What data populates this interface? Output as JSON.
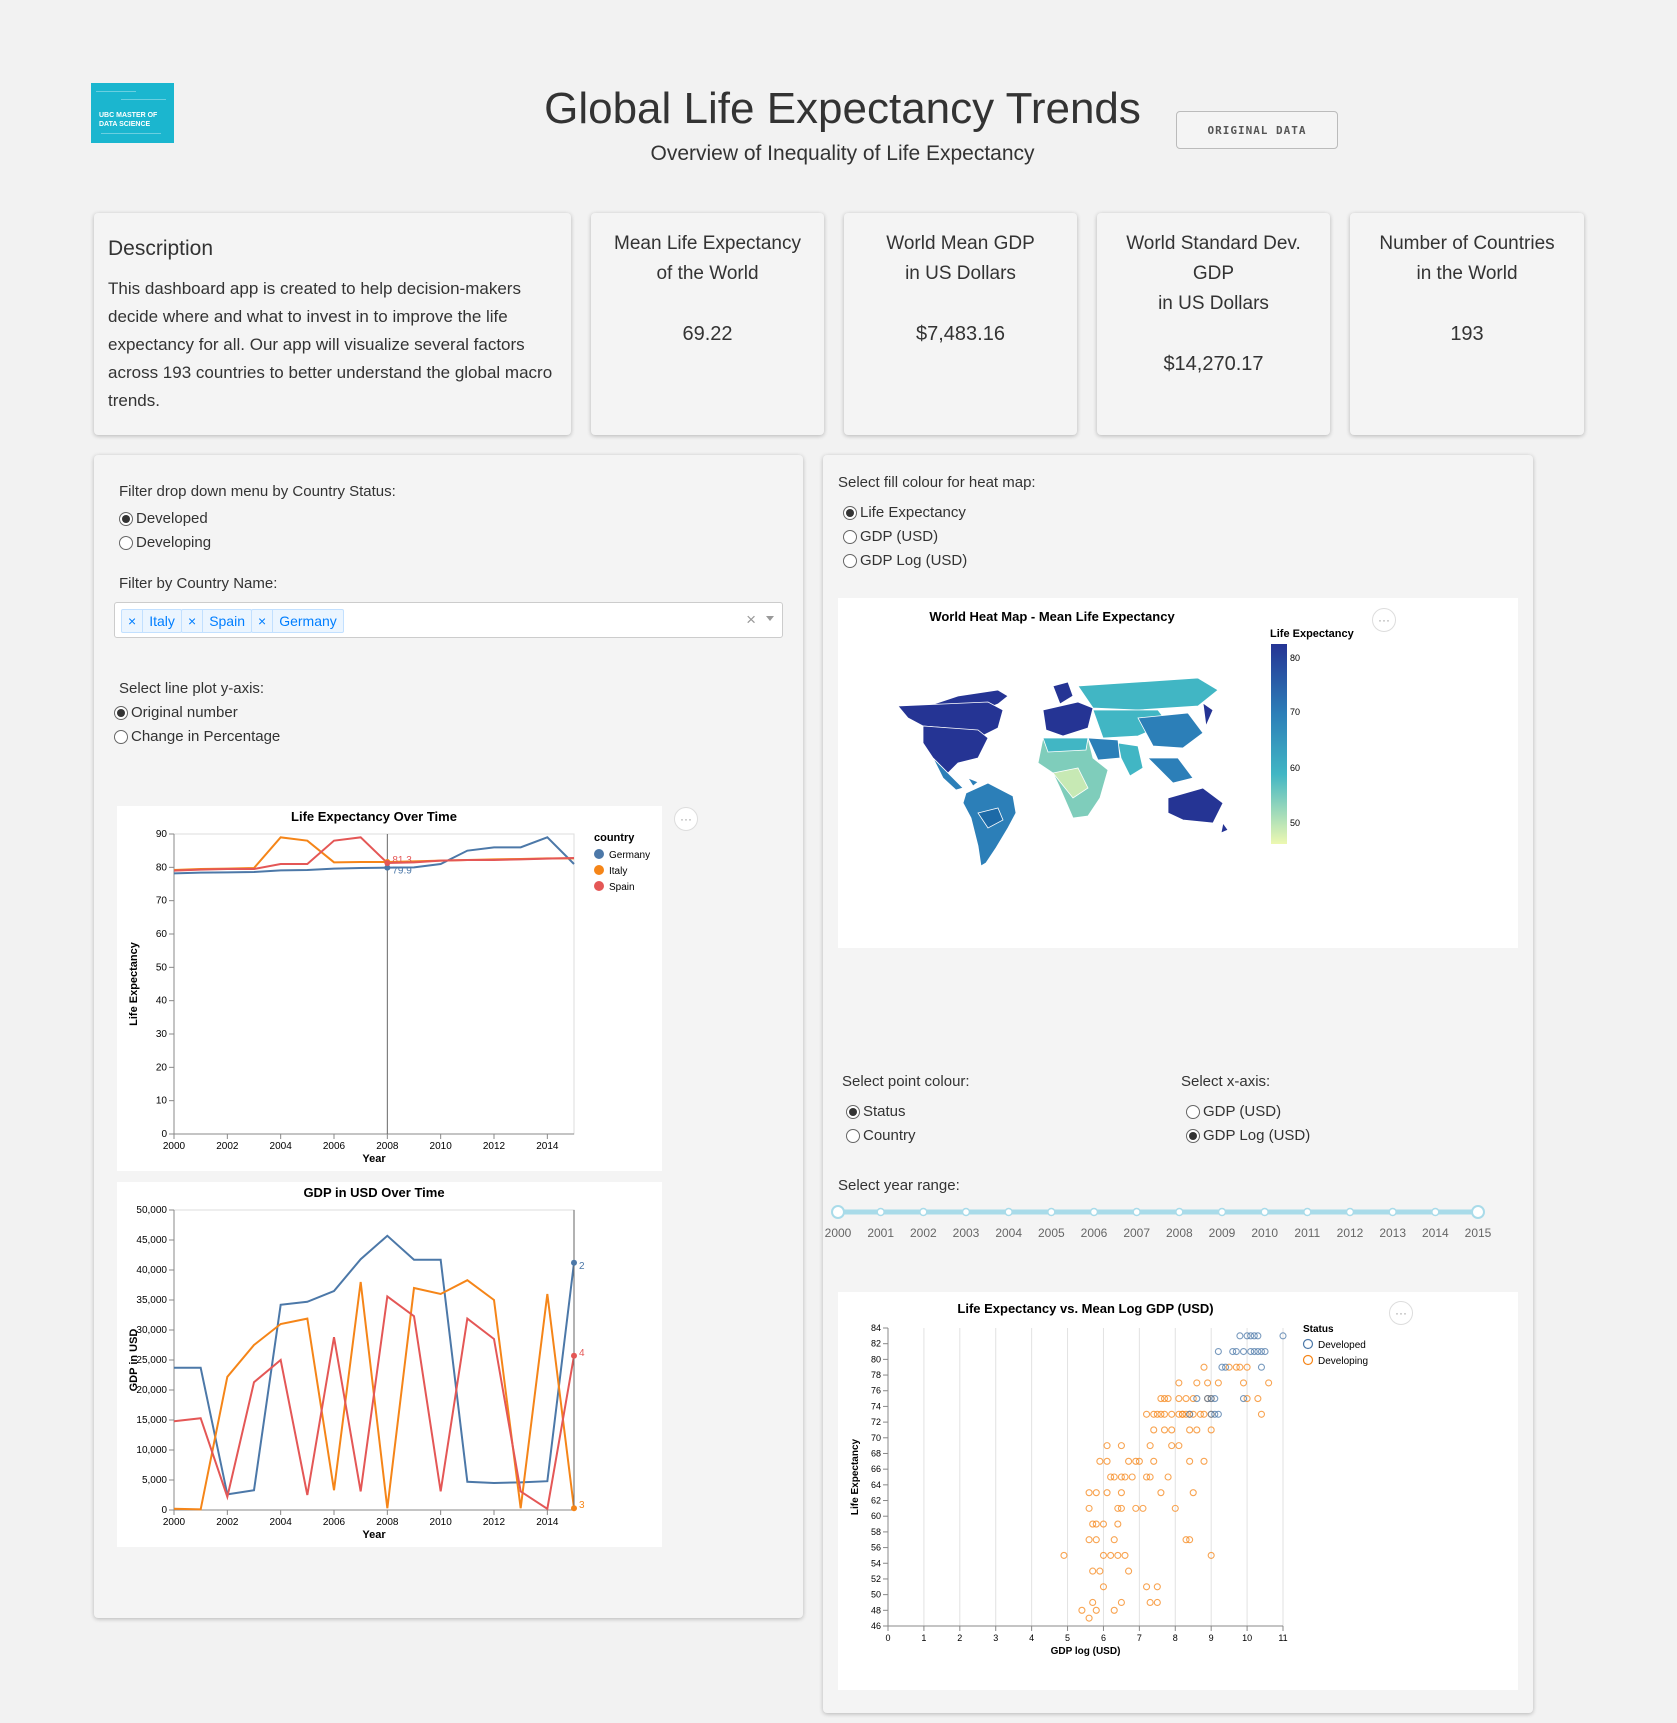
{
  "header": {
    "logo_text": "UBC MASTER OF DATA SCIENCE",
    "title": "Global Life Expectancy Trends",
    "subtitle": "Overview of Inequality of Life Expectancy",
    "original_data_button": "ORIGINAL DATA"
  },
  "description": {
    "title": "Description",
    "text": "This dashboard app is created to help decision-makers decide where and what to invest in to improve the life expectancy for all. Our app will visualize several factors across 193 countries to better understand the global macro trends."
  },
  "stats": [
    {
      "label1": "Mean Life Expectancy",
      "label2": "of the World",
      "label3": "",
      "value": "69.22"
    },
    {
      "label1": "World Mean GDP",
      "label2": "in US Dollars",
      "label3": "",
      "value": "$7,483.16"
    },
    {
      "label1": "World Standard Dev.",
      "label2": "GDP",
      "label3": "in US Dollars",
      "value": "$14,270.17"
    },
    {
      "label1": "Number of Countries",
      "label2": "in the World",
      "label3": "",
      "value": "193"
    }
  ],
  "left_panel": {
    "status_filter_label": "Filter drop down menu by Country Status:",
    "status_options": [
      "Developed",
      "Developing"
    ],
    "status_selected": "Developed",
    "country_filter_label": "Filter by Country Name:",
    "selected_countries": [
      "Italy",
      "Spain",
      "Germany"
    ],
    "clear_icon": "×",
    "yaxis_label": "Select line plot y-axis:",
    "yaxis_options": [
      "Original number",
      "Change in Percentage"
    ],
    "yaxis_selected": "Original number"
  },
  "right_panel": {
    "fill_label": "Select fill colour for heat map:",
    "fill_options": [
      "Life Expectancy",
      "GDP (USD)",
      "GDP Log (USD)"
    ],
    "fill_selected": "Life Expectancy",
    "point_colour_label": "Select point colour:",
    "point_colour_options": [
      "Status",
      "Country"
    ],
    "point_colour_selected": "Status",
    "xaxis_label": "Select x-axis:",
    "xaxis_options": [
      "GDP (USD)",
      "GDP Log (USD)"
    ],
    "xaxis_selected": "GDP Log (USD)",
    "year_range_label": "Select year range:",
    "year_range": [
      2000,
      2015
    ],
    "slider_marks": [
      "2000",
      "2001",
      "2002",
      "2003",
      "2004",
      "2005",
      "2006",
      "2007",
      "2008",
      "2009",
      "2010",
      "2011",
      "2012",
      "2013",
      "2014",
      "2015"
    ]
  },
  "colors": {
    "germany": "#4c78a8",
    "italy": "#f58518",
    "spain": "#e45756",
    "developed": "#4c78a8",
    "developing": "#f58518",
    "slider": "#a9dbe9"
  },
  "chart_data": [
    {
      "type": "line",
      "title": "Life Expectancy Over Time",
      "xlabel": "Year",
      "ylabel": "Life Expectancy",
      "ylim": [
        0,
        90
      ],
      "xlim": [
        2000,
        2015
      ],
      "x_ticks": [
        "2000",
        "2002",
        "2004",
        "2006",
        "2008",
        "2010",
        "2012",
        "2014"
      ],
      "y_ticks": [
        "0",
        "10",
        "20",
        "30",
        "40",
        "50",
        "60",
        "70",
        "80",
        "90"
      ],
      "legend_title": "country",
      "x": [
        2000,
        2001,
        2002,
        2003,
        2004,
        2005,
        2006,
        2007,
        2008,
        2009,
        2010,
        2011,
        2012,
        2013,
        2014,
        2015
      ],
      "series": [
        {
          "name": "Germany",
          "values": [
            78.2,
            78.4,
            78.5,
            78.6,
            79.1,
            79.2,
            79.6,
            79.8,
            79.9,
            80.0,
            81.0,
            85.0,
            86.0,
            86.0,
            89.0,
            81.0
          ]
        },
        {
          "name": "Italy",
          "values": [
            79.2,
            79.5,
            79.6,
            79.8,
            89.0,
            88.0,
            81.5,
            81.6,
            81.6,
            81.8,
            82.0,
            82.2,
            82.4,
            82.5,
            82.7,
            82.7
          ]
        },
        {
          "name": "Spain",
          "values": [
            79.0,
            79.3,
            79.5,
            79.5,
            81.0,
            81.0,
            88.0,
            89.0,
            81.3,
            81.5,
            82.0,
            82.2,
            82.2,
            82.4,
            82.6,
            82.8
          ]
        }
      ],
      "rule_year": 2008,
      "rule_labels": [
        "81.3",
        "79.9"
      ]
    },
    {
      "type": "line",
      "title": "GDP in USD Over Time",
      "xlabel": "Year",
      "ylabel": "GDP in USD",
      "ylim": [
        0,
        50000
      ],
      "xlim": [
        2000,
        2015
      ],
      "x_ticks": [
        "2000",
        "2002",
        "2004",
        "2006",
        "2008",
        "2010",
        "2012",
        "2014"
      ],
      "y_ticks": [
        "0",
        "5,000",
        "10,000",
        "15,000",
        "20,000",
        "25,000",
        "30,000",
        "35,000",
        "40,000",
        "45,000",
        "50,000"
      ],
      "x": [
        2000,
        2001,
        2002,
        2003,
        2004,
        2005,
        2006,
        2007,
        2008,
        2009,
        2010,
        2011,
        2012,
        2013,
        2014,
        2015
      ],
      "series": [
        {
          "name": "Germany",
          "values": [
            23700,
            23700,
            2600,
            3300,
            34200,
            34700,
            36500,
            41800,
            45700,
            41700,
            41700,
            4700,
            4500,
            4600,
            4800,
            41200
          ]
        },
        {
          "name": "Italy",
          "values": [
            200,
            100,
            22200,
            27500,
            31000,
            31900,
            3300,
            38000,
            300,
            37000,
            36000,
            38300,
            35000,
            300,
            36000,
            300
          ]
        },
        {
          "name": "Spain",
          "values": [
            14800,
            15300,
            2200,
            21300,
            25000,
            2500,
            28800,
            3100,
            35600,
            32300,
            3100,
            31900,
            28500,
            3100,
            200,
            25700
          ]
        }
      ],
      "rule_year": 2015,
      "rule_labels": [
        "4",
        "2",
        "3"
      ]
    },
    {
      "type": "heatmap",
      "title": "World Heat Map - Mean Life Expectancy",
      "legend_title": "Life Expectancy",
      "legend_ticks": [
        "80",
        "70",
        "60",
        "50"
      ]
    },
    {
      "type": "scatter",
      "title": "Life Expectancy vs. Mean Log GDP (USD)",
      "xlabel": "GDP log (USD)",
      "ylabel": "Life Expectancy",
      "xlim": [
        0,
        11
      ],
      "ylim": [
        46,
        84
      ],
      "x_ticks": [
        "0",
        "1",
        "2",
        "3",
        "4",
        "5",
        "6",
        "7",
        "8",
        "9",
        "10",
        "11"
      ],
      "y_ticks": [
        "46",
        "48",
        "50",
        "52",
        "54",
        "56",
        "58",
        "60",
        "62",
        "64",
        "66",
        "68",
        "70",
        "72",
        "74",
        "76",
        "78",
        "80",
        "82",
        "84"
      ],
      "legend_title": "Status",
      "series": [
        {
          "name": "Developed",
          "points": [
            [
              9.8,
              83
            ],
            [
              10.0,
              83
            ],
            [
              10.1,
              83
            ],
            [
              10.2,
              83
            ],
            [
              10.3,
              83
            ],
            [
              11.0,
              83
            ],
            [
              9.2,
              81
            ],
            [
              9.6,
              81
            ],
            [
              9.7,
              81
            ],
            [
              9.9,
              81
            ],
            [
              10.1,
              81
            ],
            [
              10.2,
              81
            ],
            [
              10.3,
              81
            ],
            [
              10.4,
              81
            ],
            [
              10.5,
              81
            ],
            [
              9.3,
              79
            ],
            [
              9.4,
              79
            ],
            [
              10.4,
              79
            ],
            [
              8.6,
              75
            ],
            [
              8.9,
              75
            ],
            [
              9.0,
              75
            ],
            [
              9.1,
              75
            ],
            [
              9.9,
              75
            ],
            [
              8.4,
              73
            ],
            [
              9.0,
              73
            ],
            [
              9.1,
              73
            ],
            [
              9.2,
              73
            ]
          ]
        },
        {
          "name": "Developing",
          "points": [
            [
              9.5,
              79
            ],
            [
              9.7,
              79
            ],
            [
              9.8,
              79
            ],
            [
              10.0,
              79
            ],
            [
              8.8,
              79
            ],
            [
              8.1,
              77
            ],
            [
              8.6,
              77
            ],
            [
              8.9,
              77
            ],
            [
              9.2,
              77
            ],
            [
              9.9,
              77
            ],
            [
              10.6,
              77
            ],
            [
              9.0,
              75
            ],
            [
              7.6,
              75
            ],
            [
              7.7,
              75
            ],
            [
              7.8,
              75
            ],
            [
              8.1,
              75
            ],
            [
              8.3,
              75
            ],
            [
              8.5,
              75
            ],
            [
              8.9,
              75
            ],
            [
              10.0,
              75
            ],
            [
              10.3,
              75
            ],
            [
              8.2,
              73
            ],
            [
              7.2,
              73
            ],
            [
              7.4,
              73
            ],
            [
              7.5,
              73
            ],
            [
              7.6,
              73
            ],
            [
              7.7,
              73
            ],
            [
              7.9,
              73
            ],
            [
              8.1,
              73
            ],
            [
              8.2,
              73
            ],
            [
              8.3,
              73
            ],
            [
              8.4,
              73
            ],
            [
              8.5,
              73
            ],
            [
              8.7,
              73
            ],
            [
              8.8,
              73
            ],
            [
              9.0,
              73
            ],
            [
              10.4,
              73
            ],
            [
              7.4,
              71
            ],
            [
              7.7,
              71
            ],
            [
              7.9,
              71
            ],
            [
              8.4,
              71
            ],
            [
              8.6,
              71
            ],
            [
              9.0,
              71
            ],
            [
              6.1,
              69
            ],
            [
              6.5,
              69
            ],
            [
              7.3,
              69
            ],
            [
              7.9,
              69
            ],
            [
              8.1,
              69
            ],
            [
              5.9,
              67
            ],
            [
              6.1,
              67
            ],
            [
              6.7,
              67
            ],
            [
              6.9,
              67
            ],
            [
              7.0,
              67
            ],
            [
              7.4,
              67
            ],
            [
              8.4,
              67
            ],
            [
              8.8,
              67
            ],
            [
              6.2,
              65
            ],
            [
              6.3,
              65
            ],
            [
              6.5,
              65
            ],
            [
              6.6,
              65
            ],
            [
              6.8,
              65
            ],
            [
              7.2,
              65
            ],
            [
              7.3,
              65
            ],
            [
              7.8,
              65
            ],
            [
              6.1,
              63
            ],
            [
              6.5,
              63
            ],
            [
              7.6,
              63
            ],
            [
              8.5,
              63
            ],
            [
              5.6,
              63
            ],
            [
              5.8,
              63
            ],
            [
              6.4,
              61
            ],
            [
              6.5,
              61
            ],
            [
              6.9,
              61
            ],
            [
              7.1,
              61
            ],
            [
              8.0,
              61
            ],
            [
              5.6,
              61
            ],
            [
              5.7,
              59
            ],
            [
              5.8,
              59
            ],
            [
              6.0,
              59
            ],
            [
              6.4,
              59
            ],
            [
              5.6,
              57
            ],
            [
              5.8,
              57
            ],
            [
              6.3,
              57
            ],
            [
              8.3,
              57
            ],
            [
              8.4,
              57
            ],
            [
              4.9,
              55
            ],
            [
              6.0,
              55
            ],
            [
              6.2,
              55
            ],
            [
              6.4,
              55
            ],
            [
              6.6,
              55
            ],
            [
              9.0,
              55
            ],
            [
              5.7,
              53
            ],
            [
              5.9,
              53
            ],
            [
              6.7,
              53
            ],
            [
              6.0,
              51
            ],
            [
              7.2,
              51
            ],
            [
              7.5,
              51
            ],
            [
              5.7,
              49
            ],
            [
              6.5,
              49
            ],
            [
              7.3,
              49
            ],
            [
              7.5,
              49
            ],
            [
              5.4,
              48
            ],
            [
              5.8,
              48
            ],
            [
              6.3,
              48
            ],
            [
              5.6,
              47
            ]
          ]
        }
      ]
    }
  ]
}
